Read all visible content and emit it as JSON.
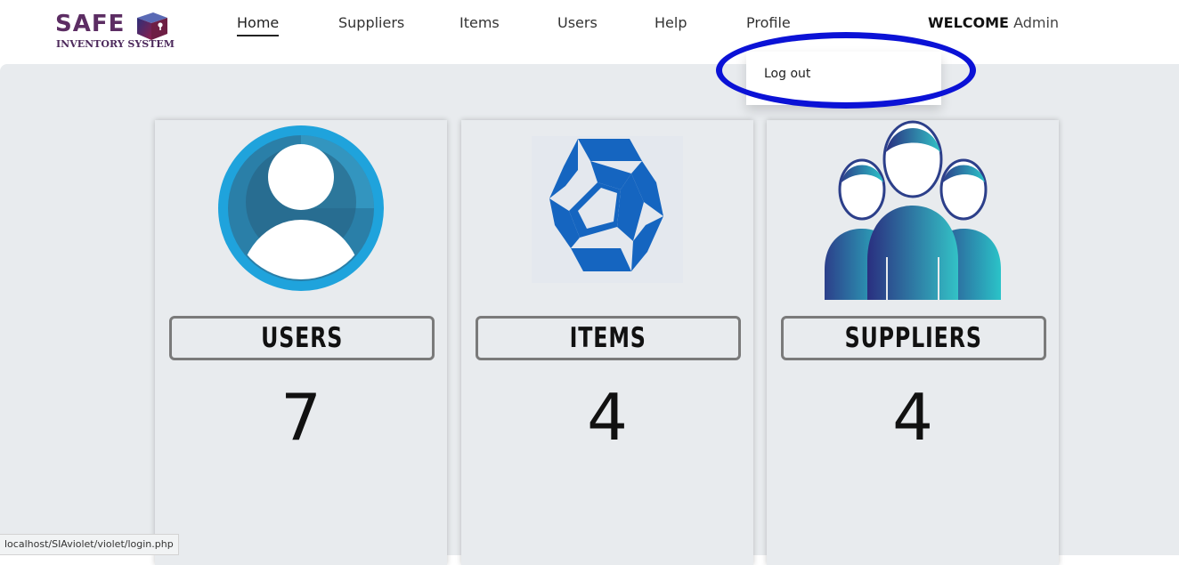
{
  "logo": {
    "brand": "SAFE",
    "subtitle": "INVENTORY SYSTEM"
  },
  "nav": {
    "home": "Home",
    "suppliers": "Suppliers",
    "items": "Items",
    "users": "Users",
    "help": "Help",
    "profile": "Profile"
  },
  "welcome": {
    "prefix": "WELCOME",
    "user": "Admin"
  },
  "dropdown": {
    "logout": "Log out"
  },
  "cards": [
    {
      "label": "USERS",
      "count": "7",
      "icon": "user-avatar-icon"
    },
    {
      "label": "ITEMS",
      "count": "4",
      "icon": "cube-icon"
    },
    {
      "label": "SUPPLIERS",
      "count": "4",
      "icon": "people-group-icon"
    }
  ],
  "status": {
    "url": "localhost/SIAviolet/violet/login.php"
  },
  "colors": {
    "brand": "#5c2d63",
    "background": "#e8ebee",
    "highlight": "#0b12d6",
    "users_icon": "#1fa3dc",
    "items_icon": "#1565c0",
    "suppliers_icon": "#2bb5c8"
  }
}
